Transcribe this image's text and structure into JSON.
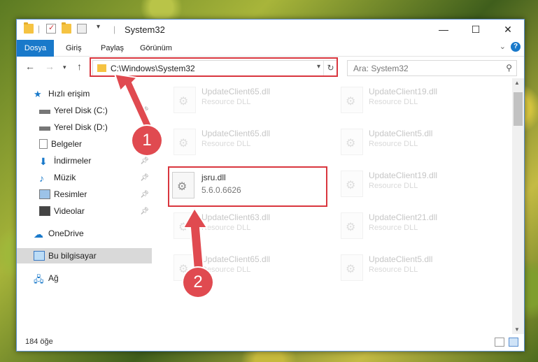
{
  "window": {
    "title": "System32",
    "minimize": "—",
    "maximize": "☐",
    "close": "✕"
  },
  "ribbon": {
    "tabs": [
      "Dosya",
      "Giriş",
      "Paylaş",
      "Görünüm"
    ],
    "help": "?"
  },
  "navbar": {
    "address": "C:\\Windows\\System32",
    "search_placeholder": "Ara: System32"
  },
  "sidebar": {
    "items": [
      {
        "label": "Hızlı erişim",
        "icon": "star-icon"
      },
      {
        "label": "Yerel Disk (C:)",
        "icon": "drive-icon"
      },
      {
        "label": "Yerel Disk (D:)",
        "icon": "drive-icon"
      },
      {
        "label": "Belgeler",
        "icon": "document-icon"
      },
      {
        "label": "İndirmeler",
        "icon": "download-icon"
      },
      {
        "label": "Müzik",
        "icon": "music-icon"
      },
      {
        "label": "Resimler",
        "icon": "pictures-icon"
      },
      {
        "label": "Videolar",
        "icon": "video-icon"
      },
      {
        "label": "OneDrive",
        "icon": "cloud-icon"
      },
      {
        "label": "Bu bilgisayar",
        "icon": "computer-icon"
      },
      {
        "label": "Ağ",
        "icon": "network-icon"
      }
    ]
  },
  "files": {
    "left": [
      {
        "name": "UpdateClient65.dll",
        "sub": "Resource DLL"
      },
      {
        "name": "UpdateClient65.dll",
        "sub": "Resource DLL"
      },
      {
        "name": "jsru.dll",
        "sub": "5.6.0.6626"
      },
      {
        "name": "UpdateClient63.dll",
        "sub": "Resource DLL"
      },
      {
        "name": "UpdateClient65.dll",
        "sub": "Resource DLL"
      }
    ],
    "right": [
      {
        "name": "UpdateClient19.dll",
        "sub": "Resource DLL"
      },
      {
        "name": "UpdateClient5.dll",
        "sub": "Resource DLL"
      },
      {
        "name": "UpdateClient19.dll",
        "sub": "Resource DLL"
      },
      {
        "name": "UpdateClient21.dll",
        "sub": "Resource DLL"
      },
      {
        "name": "UpdateClient5.dll",
        "sub": "Resource DLL"
      }
    ]
  },
  "status": {
    "count": "184 öğe"
  },
  "annotations": {
    "badge1": "1",
    "badge2": "2",
    "color": "#e04a50"
  }
}
